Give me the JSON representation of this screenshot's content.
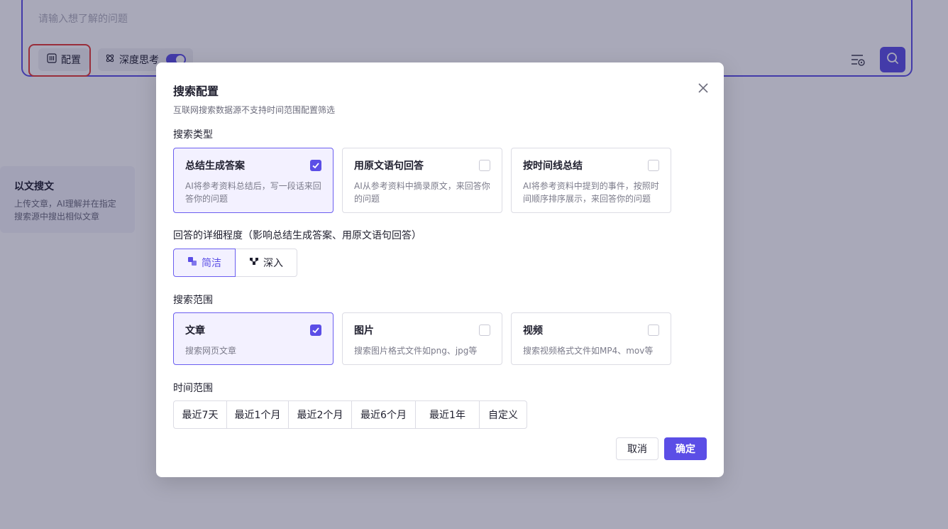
{
  "background": {
    "query_placeholder": "请输入想了解的问题",
    "config_label": "配置",
    "deep_think_label": "深度思考",
    "deep_think_enabled": true,
    "side_card": {
      "title": "以文搜文",
      "description": "上传文章，AI理解并在指定搜索源中搜出相似文章"
    }
  },
  "modal": {
    "title": "搜索配置",
    "subtitle": "互联网搜索数据源不支持时间范围配置筛选",
    "search_type": {
      "label": "搜索类型",
      "options": [
        {
          "title": "总结生成答案",
          "desc": "AI将参考资料总结后，写一段话来回答你的问题",
          "checked": true
        },
        {
          "title": "用原文语句回答",
          "desc": "AI从参考资料中摘录原文，来回答你的问题",
          "checked": false
        },
        {
          "title": "按时间线总结",
          "desc": "AI将参考资料中提到的事件，按照时间顺序排序展示，来回答你的问题",
          "checked": false
        }
      ]
    },
    "detail_level": {
      "label": "回答的详细程度（影响总结生成答案、用原文语句回答）",
      "options": [
        {
          "label": "简洁",
          "active": true
        },
        {
          "label": "深入",
          "active": false
        }
      ]
    },
    "search_scope": {
      "label": "搜索范围",
      "options": [
        {
          "title": "文章",
          "desc": "搜索网页文章",
          "checked": true
        },
        {
          "title": "图片",
          "desc": "搜索图片格式文件如png、jpg等",
          "checked": false
        },
        {
          "title": "视频",
          "desc": "搜索视频格式文件如MP4、mov等",
          "checked": false
        }
      ]
    },
    "time_range": {
      "label": "时间范围",
      "options": [
        "最近7天",
        "最近1个月",
        "最近2个月",
        "最近6个月",
        "最近1年",
        "自定义"
      ]
    },
    "cancel_label": "取消",
    "ok_label": "确定"
  },
  "colors": {
    "accent": "#5b4ee6",
    "selected_bg": "#f3f1ff",
    "highlight_ring": "#e53935"
  }
}
